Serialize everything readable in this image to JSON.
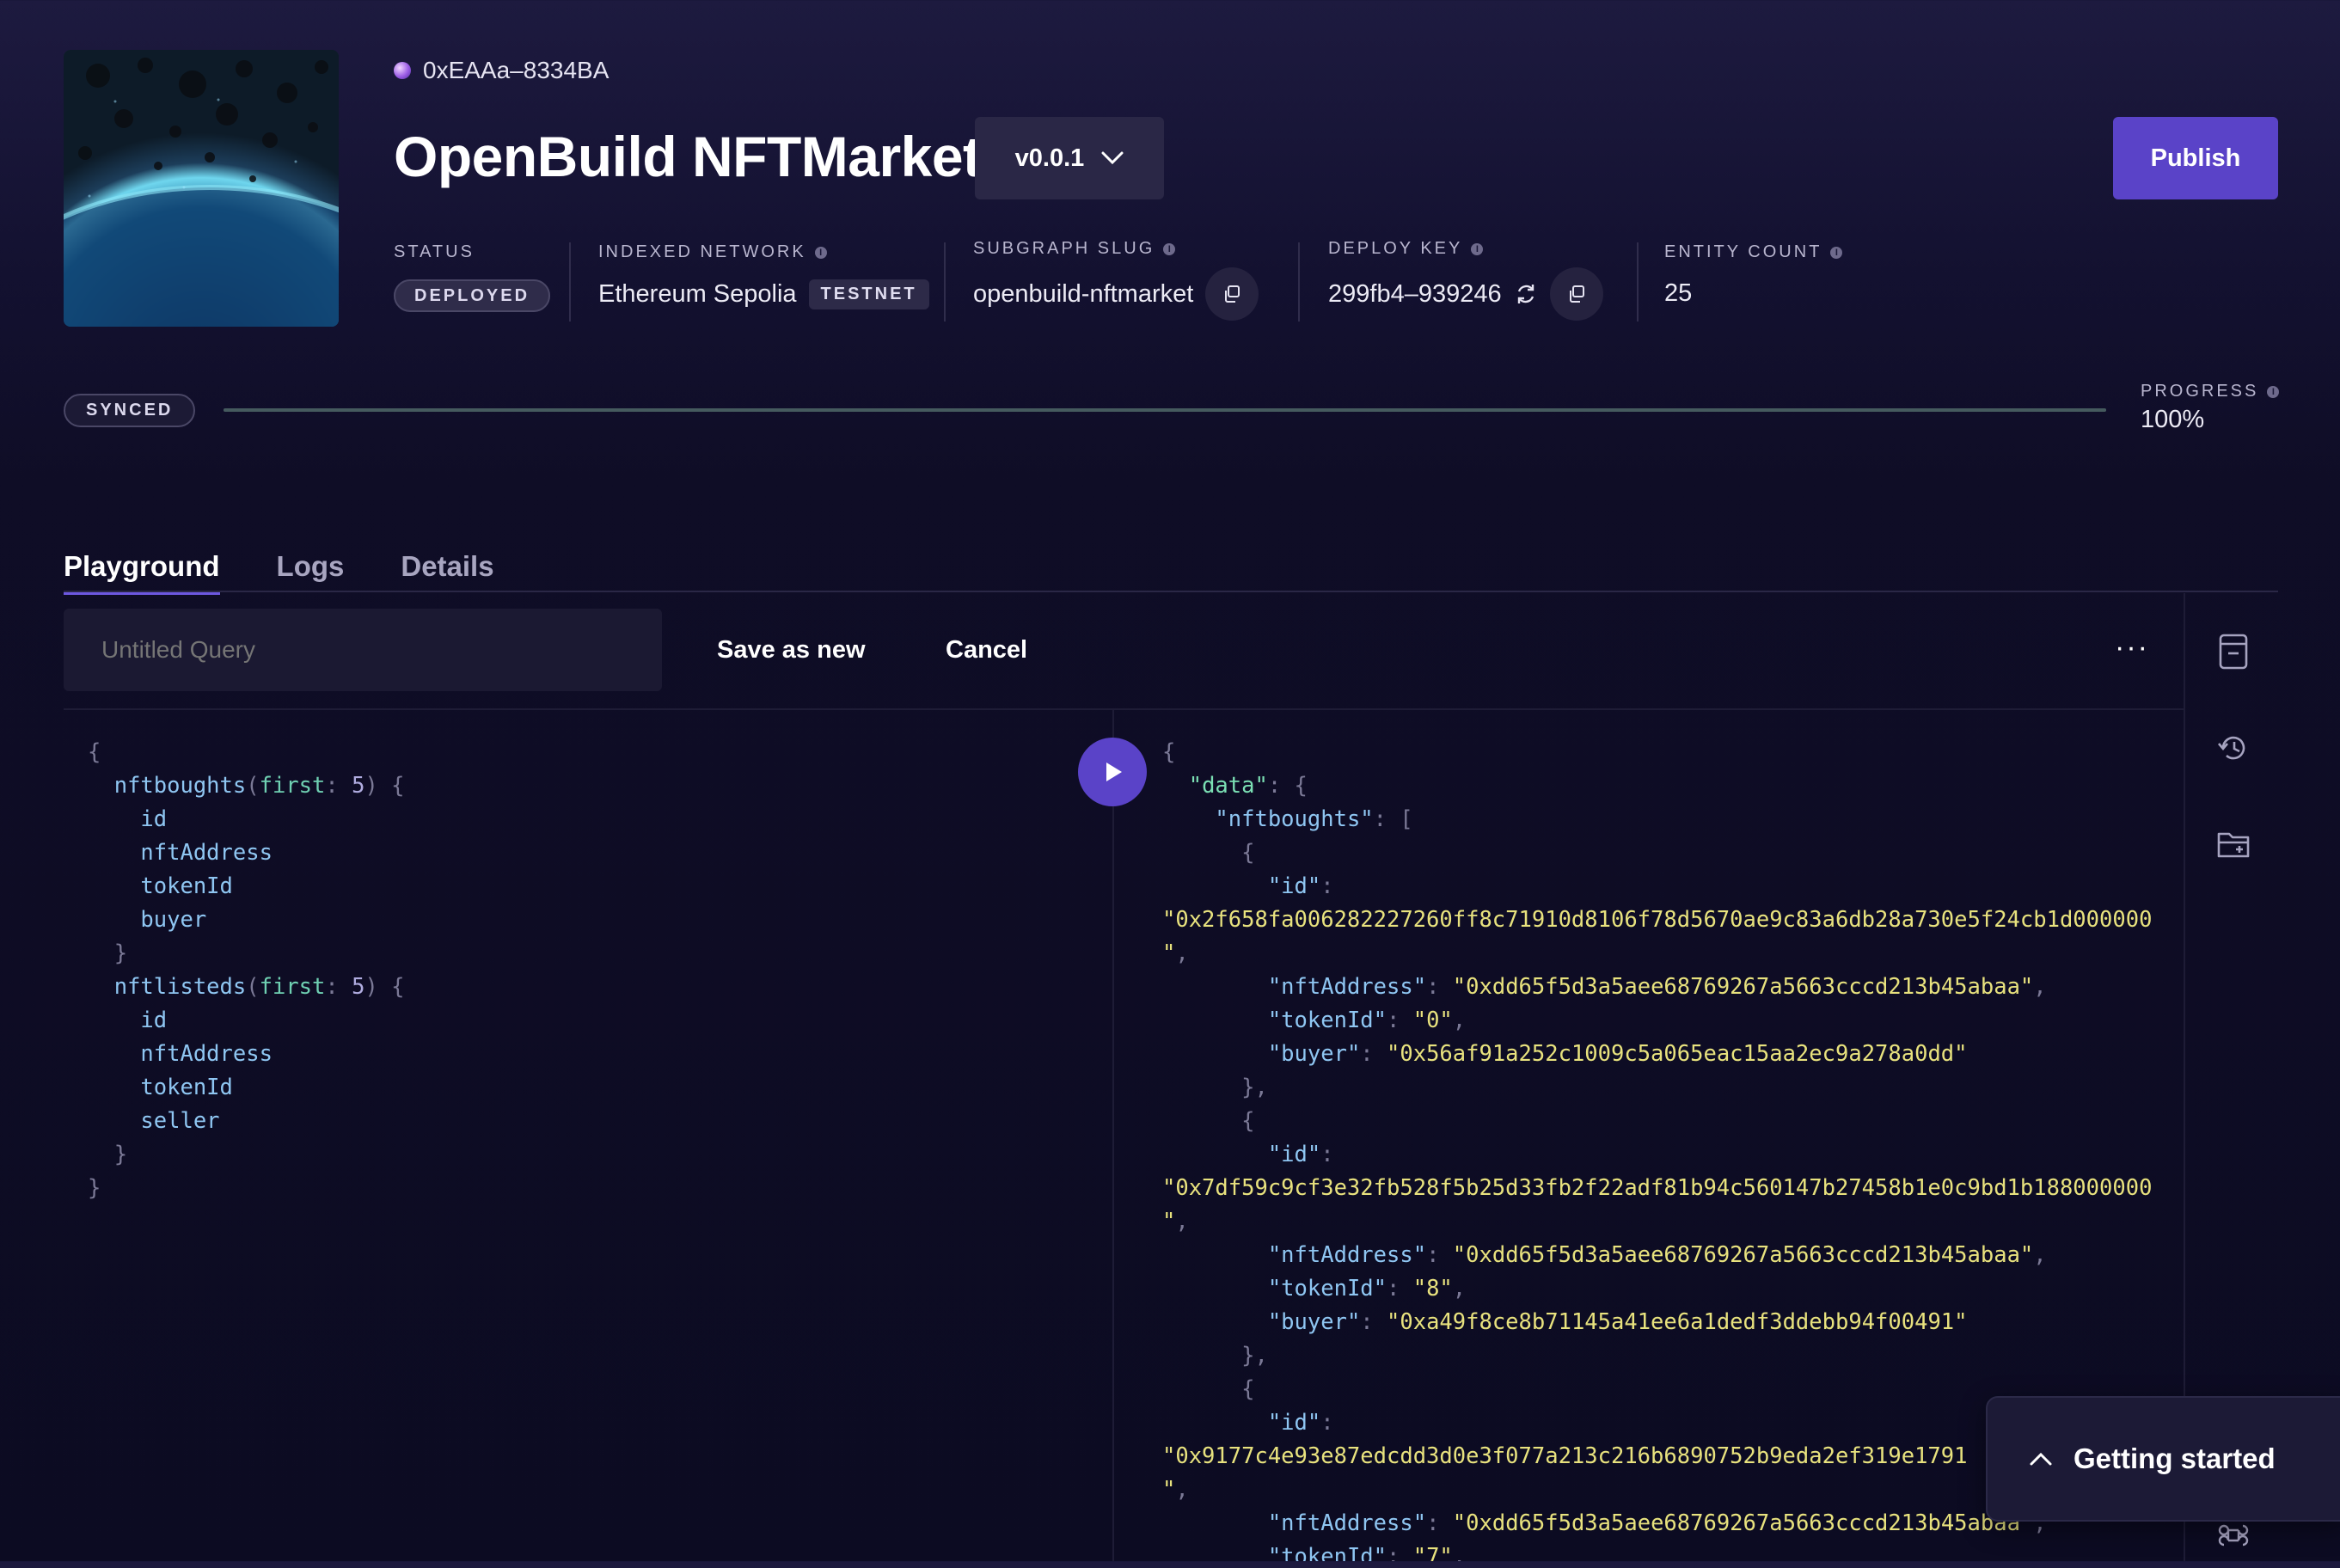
{
  "header": {
    "owner_address": "0xEAAa–8334BA",
    "title": "OpenBuild NFTMarket",
    "version": "v0.0.1",
    "publish_label": "Publish"
  },
  "meta": {
    "status_label": "STATUS",
    "status_value": "DEPLOYED",
    "network_label": "INDEXED NETWORK",
    "network_value": "Ethereum Sepolia",
    "network_badge": "TESTNET",
    "slug_label": "SUBGRAPH SLUG",
    "slug_value": "openbuild-nftmarket",
    "deploy_key_label": "DEPLOY KEY",
    "deploy_key_value": "299fb4–939246",
    "entity_count_label": "ENTITY COUNT",
    "entity_count_value": "25"
  },
  "sync": {
    "status": "SYNCED",
    "progress_label": "PROGRESS",
    "progress_value": "100%",
    "progress_fraction": 1.0
  },
  "tabs": [
    "Playground",
    "Logs",
    "Details"
  ],
  "toolbar": {
    "query_placeholder": "Untitled Query",
    "save_label": "Save as new",
    "cancel_label": "Cancel",
    "more_label": "···"
  },
  "getting_started_label": "Getting started",
  "query_lines": [
    [
      [
        "{",
        "c-punc"
      ]
    ],
    [
      [
        "  ",
        ""
      ],
      [
        "nftboughts",
        "c-field"
      ],
      [
        "(",
        "c-punc"
      ],
      [
        "first",
        "c-arg"
      ],
      [
        ": ",
        "c-punc"
      ],
      [
        "5",
        "c-num"
      ],
      [
        ") {",
        "c-punc"
      ]
    ],
    [
      [
        "    ",
        ""
      ],
      [
        "id",
        "c-field"
      ]
    ],
    [
      [
        "    ",
        ""
      ],
      [
        "nftAddress",
        "c-field"
      ]
    ],
    [
      [
        "    ",
        ""
      ],
      [
        "tokenId",
        "c-field"
      ]
    ],
    [
      [
        "    ",
        ""
      ],
      [
        "buyer",
        "c-field"
      ]
    ],
    [
      [
        "  ",
        ""
      ],
      [
        "}",
        "c-punc"
      ]
    ],
    [
      [
        "  ",
        ""
      ],
      [
        "nftlisteds",
        "c-field"
      ],
      [
        "(",
        "c-punc"
      ],
      [
        "first",
        "c-arg"
      ],
      [
        ": ",
        "c-punc"
      ],
      [
        "5",
        "c-num"
      ],
      [
        ") {",
        "c-punc"
      ]
    ],
    [
      [
        "    ",
        ""
      ],
      [
        "id",
        "c-field"
      ]
    ],
    [
      [
        "    ",
        ""
      ],
      [
        "nftAddress",
        "c-field"
      ]
    ],
    [
      [
        "    ",
        ""
      ],
      [
        "tokenId",
        "c-field"
      ]
    ],
    [
      [
        "    ",
        ""
      ],
      [
        "seller",
        "c-field"
      ]
    ],
    [
      [
        "  ",
        ""
      ],
      [
        "}",
        "c-punc"
      ]
    ],
    [
      [
        "}",
        "c-punc"
      ]
    ]
  ],
  "result_lines": [
    [
      [
        "{",
        "c-punc"
      ]
    ],
    [
      [
        "  ",
        ""
      ],
      [
        "\"data\"",
        "c-key2"
      ],
      [
        ": {",
        "c-punc"
      ]
    ],
    [
      [
        "    ",
        ""
      ],
      [
        "\"nftboughts\"",
        "c-key"
      ],
      [
        ": [",
        "c-punc"
      ]
    ],
    [
      [
        "      ",
        ""
      ],
      [
        "{",
        "c-punc"
      ]
    ],
    [
      [
        "        ",
        ""
      ],
      [
        "\"id\"",
        "c-key"
      ],
      [
        ":",
        "c-punc"
      ]
    ],
    [
      [
        "\"0x2f658fa006282227260ff8c71910d8106f78d5670ae9c83a6db28a730e5f24cb1d000000",
        "c-str"
      ]
    ],
    [
      [
        "\"",
        "c-str"
      ],
      [
        ",",
        "c-punc"
      ]
    ],
    [
      [
        "        ",
        ""
      ],
      [
        "\"nftAddress\"",
        "c-key"
      ],
      [
        ": ",
        "c-punc"
      ],
      [
        "\"0xdd65f5d3a5aee68769267a5663cccd213b45abaa\"",
        "c-str"
      ],
      [
        ",",
        "c-punc"
      ]
    ],
    [
      [
        "        ",
        ""
      ],
      [
        "\"tokenId\"",
        "c-key"
      ],
      [
        ": ",
        "c-punc"
      ],
      [
        "\"0\"",
        "c-str"
      ],
      [
        ",",
        "c-punc"
      ]
    ],
    [
      [
        "        ",
        ""
      ],
      [
        "\"buyer\"",
        "c-key"
      ],
      [
        ": ",
        "c-punc"
      ],
      [
        "\"0x56af91a252c1009c5a065eac15aa2ec9a278a0dd\"",
        "c-str"
      ]
    ],
    [
      [
        "      ",
        ""
      ],
      [
        "},",
        "c-punc"
      ]
    ],
    [
      [
        "      ",
        ""
      ],
      [
        "{",
        "c-punc"
      ]
    ],
    [
      [
        "        ",
        ""
      ],
      [
        "\"id\"",
        "c-key"
      ],
      [
        ":",
        "c-punc"
      ]
    ],
    [
      [
        "\"0x7df59c9cf3e32fb528f5b25d33fb2f22adf81b94c560147b27458b1e0c9bd1b188000000",
        "c-str"
      ]
    ],
    [
      [
        "\"",
        "c-str"
      ],
      [
        ",",
        "c-punc"
      ]
    ],
    [
      [
        "        ",
        ""
      ],
      [
        "\"nftAddress\"",
        "c-key"
      ],
      [
        ": ",
        "c-punc"
      ],
      [
        "\"0xdd65f5d3a5aee68769267a5663cccd213b45abaa\"",
        "c-str"
      ],
      [
        ",",
        "c-punc"
      ]
    ],
    [
      [
        "        ",
        ""
      ],
      [
        "\"tokenId\"",
        "c-key"
      ],
      [
        ": ",
        "c-punc"
      ],
      [
        "\"8\"",
        "c-str"
      ],
      [
        ",",
        "c-punc"
      ]
    ],
    [
      [
        "        ",
        ""
      ],
      [
        "\"buyer\"",
        "c-key"
      ],
      [
        ": ",
        "c-punc"
      ],
      [
        "\"0xa49f8ce8b71145a41ee6a1dedf3ddebb94f00491\"",
        "c-str"
      ]
    ],
    [
      [
        "      ",
        ""
      ],
      [
        "},",
        "c-punc"
      ]
    ],
    [
      [
        "      ",
        ""
      ],
      [
        "{",
        "c-punc"
      ]
    ],
    [
      [
        "        ",
        ""
      ],
      [
        "\"id\"",
        "c-key"
      ],
      [
        ":",
        "c-punc"
      ]
    ],
    [
      [
        "\"0x9177c4e93e87edcdd3d0e3f077a213c216b6890752b9eda2ef319e1791",
        "c-str"
      ]
    ],
    [
      [
        "\"",
        "c-str"
      ],
      [
        ",",
        "c-punc"
      ]
    ],
    [
      [
        "        ",
        ""
      ],
      [
        "\"nftAddress\"",
        "c-key"
      ],
      [
        ": ",
        "c-punc"
      ],
      [
        "\"0xdd65f5d3a5aee68769267a5663cccd213b45abaa\"",
        "c-str"
      ],
      [
        ",",
        "c-punc"
      ]
    ],
    [
      [
        "        ",
        ""
      ],
      [
        "\"tokenId\"",
        "c-key"
      ],
      [
        ": ",
        "c-punc"
      ],
      [
        "\"7\"",
        "c-str"
      ],
      [
        ",",
        "c-punc"
      ]
    ]
  ]
}
